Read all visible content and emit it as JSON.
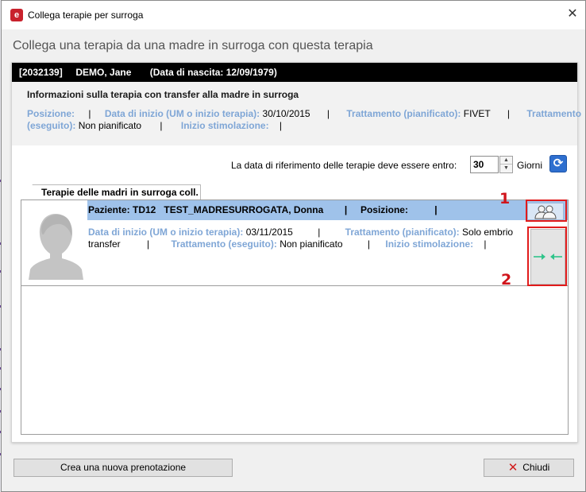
{
  "window": {
    "title": "Collega terapie per surroga",
    "close_glyph": "✕",
    "app_icon_glyph": "e"
  },
  "heading": "Collega una terapia da una madre in surroga con questa terapia",
  "patient_bar": "[2032139]     DEMO, Jane       (Data di nascita: 12/09/1979)",
  "info": {
    "title": "Informazioni sulla terapia con transfer alla madre in surroga",
    "posizione_label": "Posizione:",
    "posizione_value": "",
    "data_inizio_label": "Data di inizio (UM o inizio terapia):",
    "data_inizio_value": "30/10/2015",
    "trattamento_pianificato_label": "Trattamento (pianificato):",
    "trattamento_pianificato_value": "FIVET",
    "trattamento_label_start": "Trattamento",
    "trattamento_label_end": "(eseguito):",
    "trattamento_eseguito_value": "Non pianificato",
    "inizio_stimolazione_label": "Inizio stimolazione:",
    "inizio_stimolazione_value": "",
    "separator": "|"
  },
  "reference": {
    "label": "La data di riferimento delle terapie deve essere entro:",
    "value": "30",
    "unit": "Giorni"
  },
  "tab_label": "Terapie delle madri in surroga coll.",
  "surrogate": {
    "header": "Paziente: TD12   TEST_MADRESURROGATA, Donna        |     Posizione:          |",
    "data_inizio_label": "Data di inizio (UM o inizio terapia):",
    "data_inizio_value": "03/11/2015",
    "trattamento_pianificato_label": "Trattamento (pianificato):",
    "trattamento_pianificato_value_1": "Solo embrio",
    "trattamento_pianificato_value_2": "transfer",
    "trattamento_eseguito_label": "Trattamento (eseguito):",
    "trattamento_eseguito_value": "Non pianificato",
    "inizio_stimolazione_label": "Inizio stimolazione:",
    "separator": "|"
  },
  "annotations": [
    "1",
    "2"
  ],
  "buttons": {
    "new_booking": "Crea una nuova prenotazione",
    "close": "Chiudi",
    "close_glyph": "✕"
  },
  "icons": {
    "users": "users-icon",
    "link": "link-arrows-icon",
    "refresh": "refresh-icon",
    "avatar": "avatar-placeholder-icon"
  },
  "colors": {
    "label_blue": "#7fa6d6",
    "header_blue": "#9fc2ea",
    "annotation_red": "#e11b1b",
    "arrow_green": "#2fc48a"
  }
}
